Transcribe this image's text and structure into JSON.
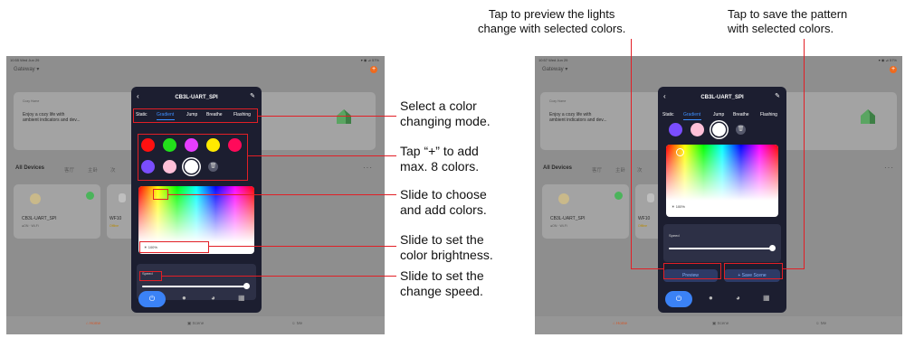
{
  "status_bar": {
    "time_left": "10:55 Wed Jun 29",
    "time_right": "10:57 Wed Jun 29",
    "indicators": "▾ ◉ ⊿ 57%"
  },
  "home": {
    "gateway": "Gateway ▾",
    "cozy_home_label": "Cozy Home",
    "cozy_text": "Enjoy a cozy life with ambient indicators and dev...",
    "all_devices": "All Devices",
    "room_tabs": [
      "客厅",
      "主卧",
      "次"
    ],
    "more": "···",
    "device1_name": "CB3L-UART_SPI",
    "device1_status": "●ON · Wi-Fi",
    "device2_name": "WF10",
    "device2_status": "Offline",
    "nav": {
      "home": "Home",
      "scene": "Scene",
      "me": "Me"
    }
  },
  "panel": {
    "title": "CB3L-UART_SPI",
    "modes": [
      "Static",
      "Gradient",
      "Jump",
      "Breathe",
      "Flashing"
    ],
    "active_mode": "Gradient",
    "brightness": "100%",
    "speed_label": "Speed",
    "preview_button": "Preview",
    "save_button": "+ Save Scene"
  },
  "swatch_colors": {
    "row1": [
      "#ff1010",
      "#22e01a",
      "#e63dff",
      "#ffea00",
      "#ff0a5a"
    ],
    "row2": [
      "#7a4dff",
      "#ffc0d8",
      "#ffffff"
    ]
  },
  "annotations": {
    "mode": [
      "Select a color",
      "changing mode."
    ],
    "add": [
      "Tap “+” to add",
      "max. 8 colors."
    ],
    "choose": [
      "Slide to choose",
      "and add colors."
    ],
    "brightness": [
      "Slide to set the",
      "color brightness."
    ],
    "speed": [
      "Slide to set the",
      "change speed."
    ],
    "preview": [
      "Tap to preview the lights",
      "change with selected colors."
    ],
    "save": [
      "Tap to save the pattern",
      "with selected colors."
    ]
  },
  "colors": {
    "accent": "#3d8fff",
    "annotation_red": "#e21f26",
    "panel_bg": "#1c1e30",
    "brand_orange": "#ef6a1e"
  }
}
